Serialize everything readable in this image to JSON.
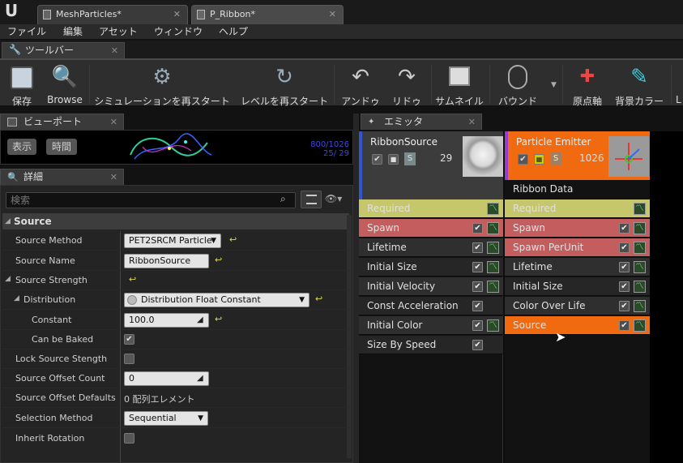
{
  "tabs": [
    {
      "label": "MeshParticles*"
    },
    {
      "label": "P_Ribbon*"
    }
  ],
  "menu": [
    "ファイル",
    "編集",
    "アセット",
    "ウィンドウ",
    "ヘルプ"
  ],
  "toolbar": {
    "tab_label": "ツールバー",
    "buttons": [
      {
        "label": "保存",
        "icon": "save-icon"
      },
      {
        "label": "Browse",
        "icon": "browse-icon"
      },
      {
        "label": "シミュレーションを再スタート",
        "icon": "restart-sim-icon"
      },
      {
        "label": "レベルを再スタート",
        "icon": "restart-level-icon"
      },
      {
        "label": "アンドゥ",
        "icon": "undo-icon"
      },
      {
        "label": "リドゥ",
        "icon": "redo-icon"
      },
      {
        "label": "サムネイル",
        "icon": "thumbnail-icon"
      },
      {
        "label": "バウンド",
        "icon": "bounds-icon"
      },
      {
        "label": "原点軸",
        "icon": "origin-axis-icon"
      },
      {
        "label": "背景カラー",
        "icon": "bg-color-icon"
      },
      {
        "label": "L",
        "icon": "lod-icon"
      }
    ]
  },
  "viewport": {
    "tab_label": "ビューポート",
    "show_label": "表示",
    "time_label": "時間",
    "stat_line1": "800/1026",
    "stat_line2": "25/  29"
  },
  "details": {
    "tab_label": "詳細",
    "search_placeholder": "検索",
    "category": "Source",
    "rows": [
      {
        "label": "Source Method",
        "value": "PET2SRCM Particle"
      },
      {
        "label": "Source Name",
        "value": "RibbonSource"
      },
      {
        "label": "Source Strength",
        "value": ""
      },
      {
        "label": "Distribution",
        "value": "Distribution Float Constant"
      },
      {
        "label": "Constant",
        "value": "100.0"
      },
      {
        "label": "Can be Baked",
        "value": "✔"
      },
      {
        "label": "Lock Source Stength",
        "value": ""
      },
      {
        "label": "Source Offset Count",
        "value": "0"
      },
      {
        "label": "Source Offset Defaults",
        "value": "0 配列エレメント"
      },
      {
        "label": "Selection Method",
        "value": "Sequential"
      },
      {
        "label": "Inherit Rotation",
        "value": ""
      }
    ]
  },
  "emitters": {
    "tab_label": "エミッタ",
    "columns": [
      {
        "name": "RibbonSource",
        "count": "29",
        "s_label": "S",
        "modules": [
          {
            "label": "Required",
            "color": "#c6c66a"
          },
          {
            "label": "Spawn",
            "color": "#c45e5e"
          },
          {
            "label": "Lifetime",
            "color": "#2f2f2f"
          },
          {
            "label": "Initial Size",
            "color": "#262626"
          },
          {
            "label": "Initial Velocity",
            "color": "#2f2f2f"
          },
          {
            "label": "Const Acceleration",
            "color": "#262626"
          },
          {
            "label": "Initial Color",
            "color": "#2f2f2f"
          },
          {
            "label": "Size By Speed",
            "color": "#262626"
          }
        ]
      },
      {
        "name": "Particle Emitter",
        "count": "1026",
        "s_label": "S",
        "type_data": "Ribbon Data",
        "modules": [
          {
            "label": "Required",
            "color": "#c6c66a"
          },
          {
            "label": "Spawn",
            "color": "#c45e5e"
          },
          {
            "label": "Spawn PerUnit",
            "color": "#c45e5e"
          },
          {
            "label": "Lifetime",
            "color": "#2f2f2f"
          },
          {
            "label": "Initial Size",
            "color": "#262626"
          },
          {
            "label": "Color Over Life",
            "color": "#2f2f2f"
          },
          {
            "label": "Source",
            "color": "#f26a0f"
          }
        ]
      }
    ]
  },
  "colors": {
    "accent_orange": "#f26a0f",
    "selected_blue": "#3355cc"
  }
}
